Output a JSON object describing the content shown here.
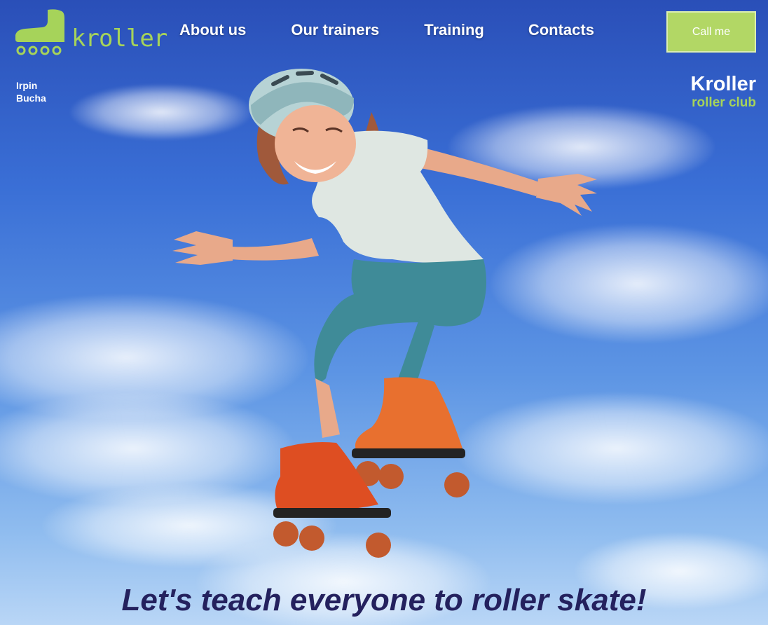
{
  "logo": {
    "text": "kroller",
    "icon": "roller-skate-icon"
  },
  "nav": {
    "items": [
      "About us",
      "Our trainers",
      "Training",
      "Contacts"
    ]
  },
  "call_button": {
    "label": "Call me"
  },
  "cities": [
    "Irpin",
    "Bucha"
  ],
  "brand": {
    "name": "Kroller",
    "subtitle": "roller club"
  },
  "hero": {
    "tagline": "Let's teach everyone to roller skate!"
  },
  "colors": {
    "accent": "#b2d765",
    "logo_green": "#a6d35a",
    "tagline": "#24215e",
    "sky_top": "#2a4fb8",
    "sky_bottom": "#b9d6f6"
  }
}
